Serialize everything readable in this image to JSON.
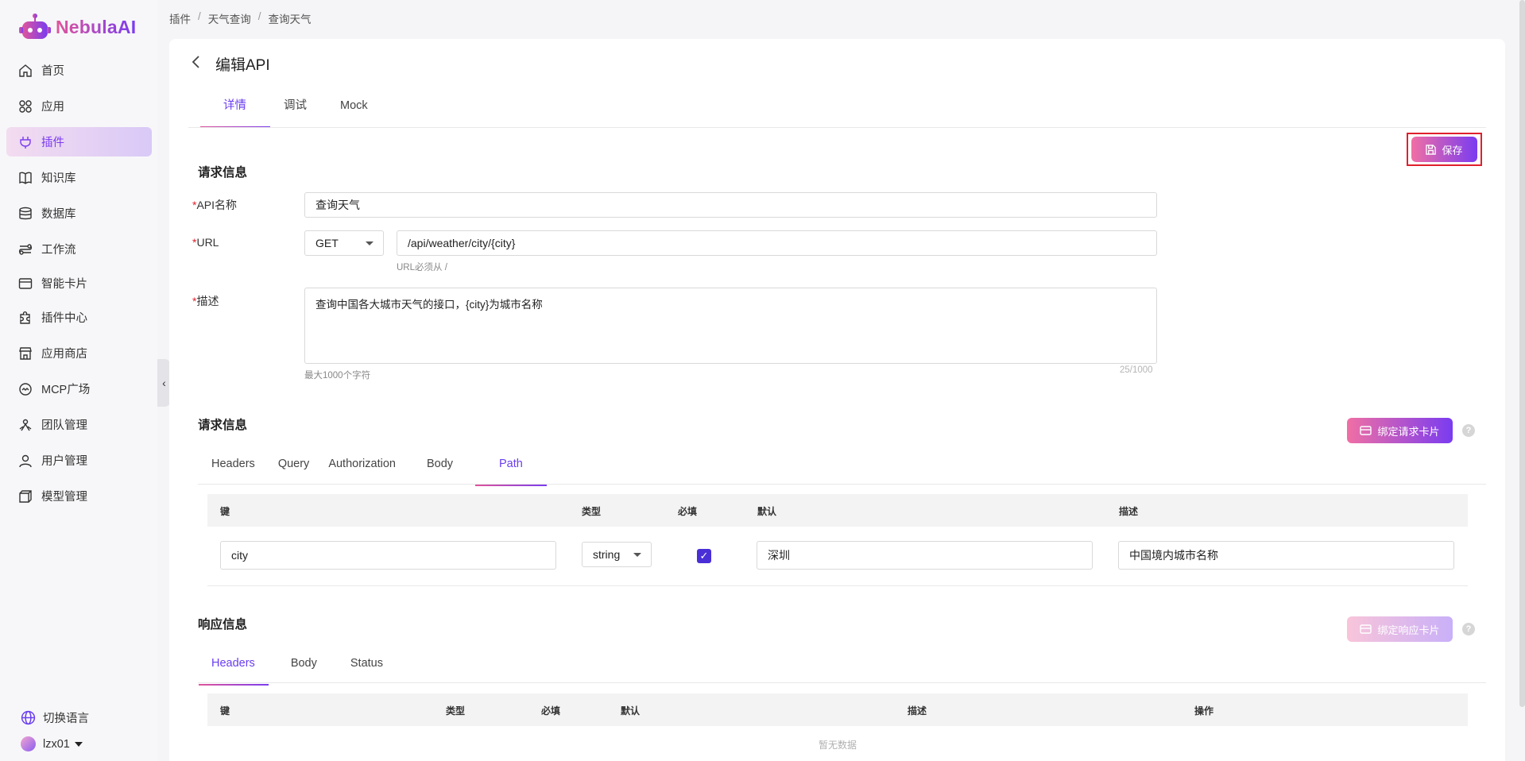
{
  "brand": {
    "name": "NebulaAI"
  },
  "sidebar": {
    "items": [
      {
        "label": "首页",
        "icon": "home-icon"
      },
      {
        "label": "应用",
        "icon": "apps-icon"
      },
      {
        "label": "插件",
        "icon": "plug-icon",
        "active": true
      },
      {
        "label": "知识库",
        "icon": "book-icon"
      },
      {
        "label": "数据库",
        "icon": "database-icon"
      },
      {
        "label": "工作流",
        "icon": "workflow-icon"
      },
      {
        "label": "智能卡片",
        "icon": "card-icon"
      },
      {
        "label": "插件中心",
        "icon": "puzzle-icon"
      },
      {
        "label": "应用商店",
        "icon": "store-icon"
      },
      {
        "label": "MCP广场",
        "icon": "mcp-icon"
      },
      {
        "label": "团队管理",
        "icon": "team-icon"
      },
      {
        "label": "用户管理",
        "icon": "user-icon"
      },
      {
        "label": "模型管理",
        "icon": "model-icon"
      }
    ],
    "language": "切换语言",
    "username": "lzx01"
  },
  "breadcrumb": [
    "插件",
    "天气查询",
    "查询天气"
  ],
  "page": {
    "title": "编辑API",
    "tabs": [
      "详情",
      "调试",
      "Mock"
    ],
    "save_label": "保存"
  },
  "request_info": {
    "title": "请求信息",
    "api_name_label": "API名称",
    "api_name_value": "查询天气",
    "url_label": "URL",
    "method": "GET",
    "url_value": "/api/weather/city/{city}",
    "url_hint": "URL必须从 /",
    "desc_label": "描述",
    "desc_value": "查询中国各大城市天气的接口，{city}为城市名称",
    "desc_hint": "最大1000个字符",
    "desc_count": "25/1000"
  },
  "request_params": {
    "title": "请求信息",
    "bind_label": "绑定请求卡片",
    "tabs": [
      "Headers",
      "Query",
      "Authorization",
      "Body",
      "Path"
    ],
    "columns": [
      "键",
      "类型",
      "必填",
      "默认",
      "描述"
    ],
    "row": {
      "key": "city",
      "type": "string",
      "required": true,
      "default": "深圳",
      "desc": "中国境内城市名称"
    }
  },
  "response": {
    "title": "响应信息",
    "bind_label": "绑定响应卡片",
    "tabs": [
      "Headers",
      "Body",
      "Status"
    ],
    "columns": [
      "键",
      "类型",
      "必填",
      "默认",
      "描述",
      "操作"
    ],
    "empty": "暂无数据"
  },
  "colors": {
    "accent": "#6a3df0",
    "gradient_start": "#f06fa4",
    "gradient_end": "#7a3cf0",
    "required": "#e0202c"
  }
}
